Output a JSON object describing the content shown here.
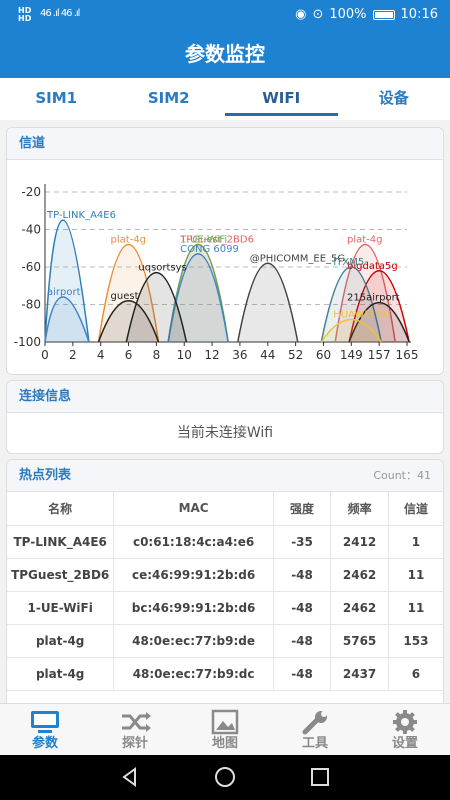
{
  "status": {
    "sim_tags": "HD 4G\nHD",
    "signal": "46 .ıl 46 .ıl",
    "battery": "100%",
    "time": "10:16"
  },
  "header": {
    "title": "参数监控"
  },
  "tabs": [
    {
      "label": "SIM1"
    },
    {
      "label": "SIM2"
    },
    {
      "label": "WIFI"
    },
    {
      "label": "设备"
    }
  ],
  "channel_card": {
    "title": "信道"
  },
  "chart_data": {
    "type": "area",
    "xlabel": "",
    "ylabel": "",
    "ylim": [
      -100,
      -20
    ],
    "yticks": [
      -20,
      -40,
      -60,
      -80,
      -100
    ],
    "x_ticks": [
      "0",
      "2",
      "4",
      "6",
      "8",
      "10",
      "12",
      "36",
      "44",
      "52",
      "60",
      "149",
      "157",
      "165"
    ],
    "grid": "dashed-horizontal",
    "series": [
      {
        "name": "TP-LINK_A4E6",
        "channel": 1,
        "peak": -35,
        "color": "#2c7fb8"
      },
      {
        "name": "TPGuest_2BD6",
        "channel": 11,
        "peak": -48,
        "color": "#e06666"
      },
      {
        "name": "1-UE-WiFi",
        "channel": 11,
        "peak": -48,
        "color": "#6aa84f"
      },
      {
        "name": "plat-4g",
        "channel": 153,
        "peak": -48,
        "color": "#e06666"
      },
      {
        "name": "plat-4g",
        "channel": 6,
        "peak": -48,
        "color": "#e69138"
      },
      {
        "name": "@PHICOMM_EE_5G",
        "channel": 44,
        "peak": -58,
        "color": "#444444"
      },
      {
        "name": "CONG 6099",
        "channel": 11,
        "peak": -53,
        "color": "#3d85c6"
      },
      {
        "name": "bigdata5g",
        "channel": 157,
        "peak": -62,
        "color": "#cc0000"
      },
      {
        "name": "ITXM5-",
        "channel": 149,
        "peak": -60,
        "color": "#45818e"
      },
      {
        "name": "uqsortsys",
        "channel": 8,
        "peak": -63,
        "color": "#222222"
      },
      {
        "name": "guest",
        "channel": 6,
        "peak": -78,
        "color": "#222222"
      },
      {
        "name": "215airport",
        "channel": 157,
        "peak": -79,
        "color": "#222222"
      },
      {
        "name": "HUAWEI 5G",
        "channel": 149,
        "peak": -88,
        "color": "#f1c232"
      },
      {
        "name": "airport",
        "channel": 1,
        "peak": -76,
        "color": "#3d85c6"
      }
    ]
  },
  "connection_card": {
    "title": "连接信息",
    "message": "当前未连接Wifi"
  },
  "hotspot_card": {
    "title": "热点列表",
    "count": "Count：41",
    "columns": [
      "名称",
      "MAC",
      "强度",
      "频率",
      "信道"
    ],
    "rows": [
      [
        "TP-LINK_A4E6",
        "c0:61:18:4c:a4:e6",
        "-35",
        "2412",
        "1"
      ],
      [
        "TPGuest_2BD6",
        "ce:46:99:91:2b:d6",
        "-48",
        "2462",
        "11"
      ],
      [
        "1-UE-WiFi",
        "bc:46:99:91:2b:d6",
        "-48",
        "2462",
        "11"
      ],
      [
        "plat-4g",
        "48:0e:ec:77:b9:de",
        "-48",
        "5765",
        "153"
      ],
      [
        "plat-4g",
        "48:0e:ec:77:b9:dc",
        "-48",
        "2437",
        "6"
      ]
    ]
  },
  "bottom_nav": [
    {
      "label": "参数",
      "icon": "monitor-icon"
    },
    {
      "label": "探针",
      "icon": "shuffle-icon"
    },
    {
      "label": "地图",
      "icon": "map-icon"
    },
    {
      "label": "工具",
      "icon": "wrench-icon"
    },
    {
      "label": "设置",
      "icon": "gear-icon"
    }
  ]
}
